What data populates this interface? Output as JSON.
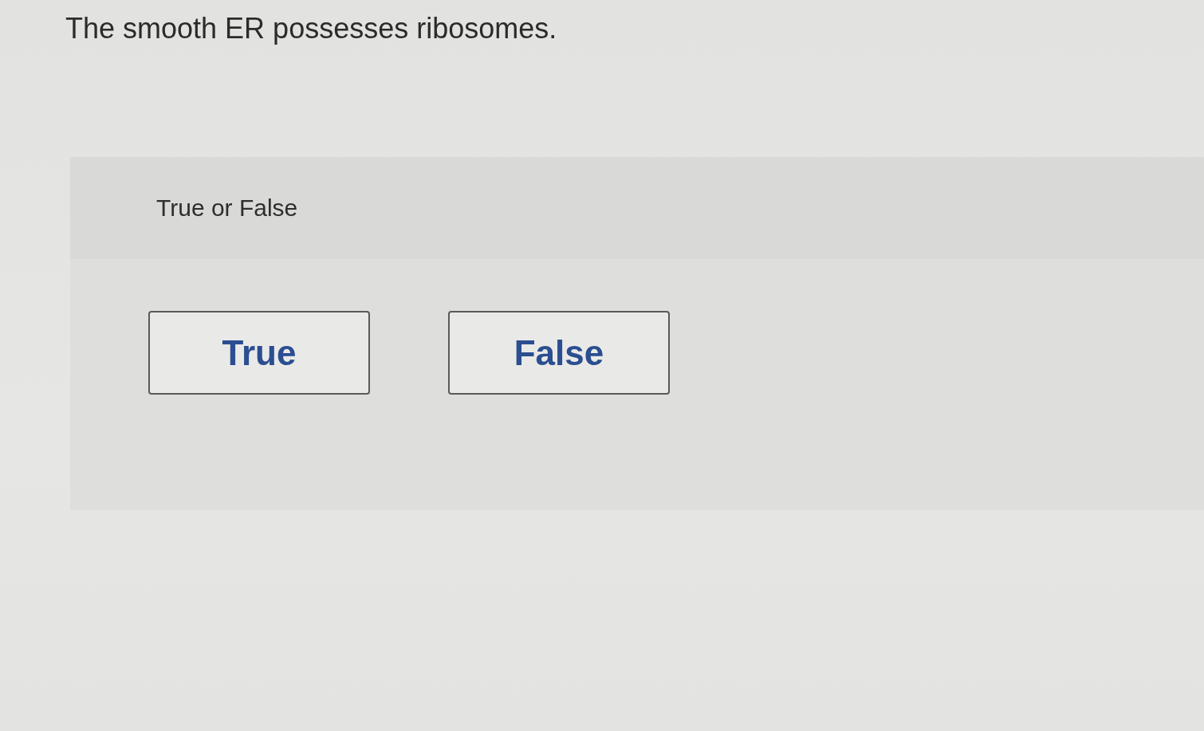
{
  "question": "The smooth ER possesses ribosomes.",
  "prompt": "True or False",
  "options": [
    {
      "label": "True",
      "selected": false
    },
    {
      "label": "False",
      "selected": false
    }
  ]
}
